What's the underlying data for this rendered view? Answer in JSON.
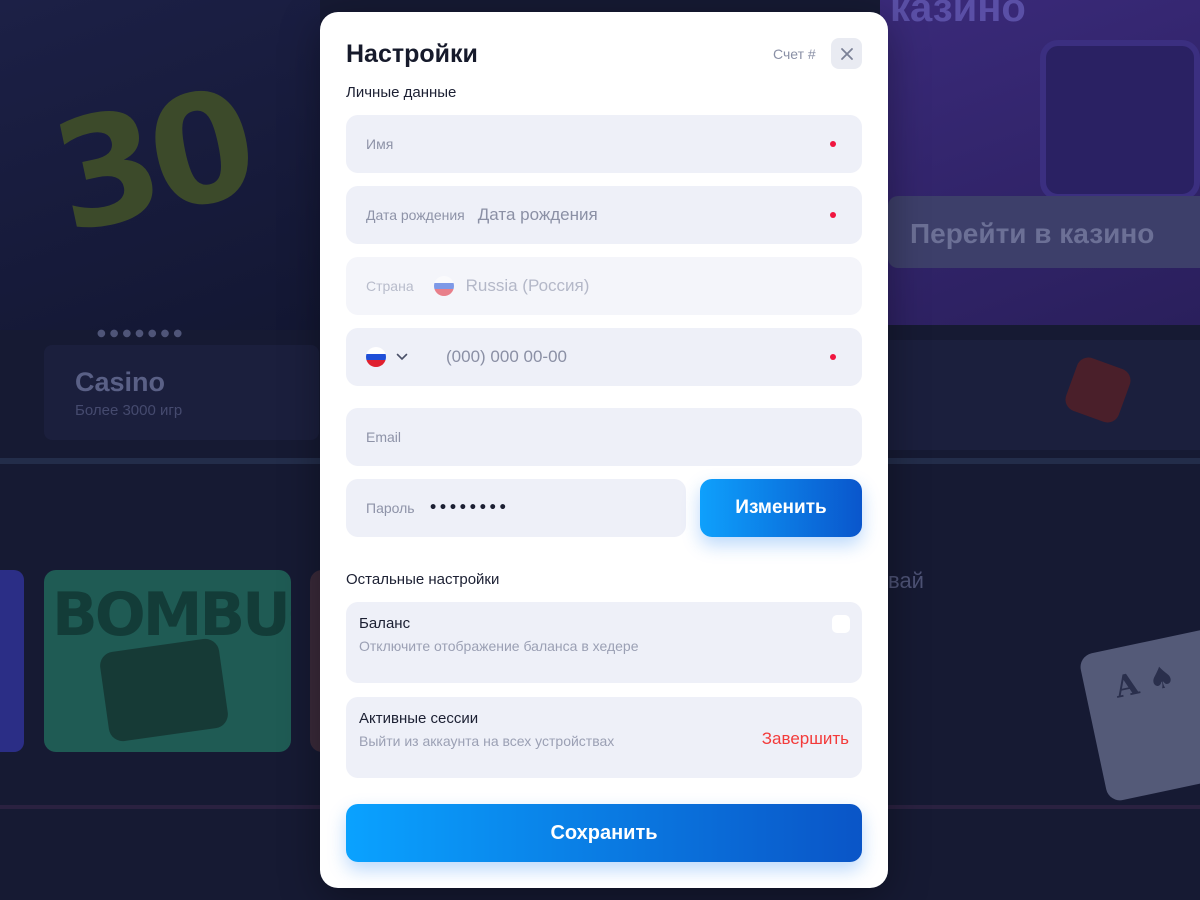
{
  "background": {
    "hero_number": "30",
    "hero_right_title": "казино",
    "goto_casino_label": "Перейти в казино",
    "casino_card_title": "Casino",
    "casino_card_subtitle": "Более 3000 игр",
    "bombucks_label": "BOMBUCKS",
    "right_partial_word": "вай",
    "ace_card": "A"
  },
  "modal": {
    "title": "Настройки",
    "account_label": "Счет #",
    "close_icon": "close-icon",
    "personal_section": "Личные данные",
    "fields": {
      "name": {
        "label": "Имя",
        "required": true
      },
      "birthdate": {
        "label": "Дата рождения",
        "placeholder": "Дата рождения",
        "required": true
      },
      "country": {
        "label": "Страна",
        "value": "Russia (Россия)",
        "disabled": true
      },
      "phone": {
        "placeholder": "(000) 000 00-00",
        "required": true
      },
      "email": {
        "label": "Email"
      },
      "password": {
        "label": "Пароль",
        "value": "••••••••"
      }
    },
    "change_button": "Изменить",
    "other_section": "Остальные настройки",
    "balance": {
      "title": "Баланс",
      "subtitle": "Отключите отображение баланса в хедере",
      "checked": false
    },
    "sessions": {
      "title": "Активные сессии",
      "subtitle": "Выйти из аккаунта на всех устройствах",
      "action": "Завершить"
    },
    "save_button": "Сохранить"
  },
  "colors": {
    "accent_start": "#0ea0fc",
    "accent_end": "#0a56cc",
    "required_dot": "#f0153f",
    "danger": "#f33b3b",
    "field_bg": "#eef0f8"
  }
}
